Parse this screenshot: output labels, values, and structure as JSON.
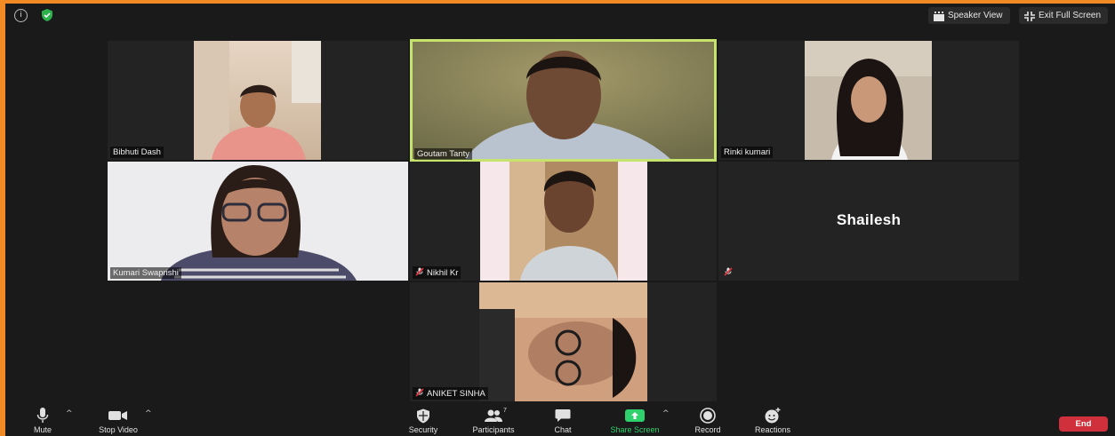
{
  "topbar": {
    "speaker_view_label": "Speaker View",
    "exit_full_screen_label": "Exit Full Screen"
  },
  "participants": [
    {
      "name": "Bibhuti Dash",
      "muted": false,
      "active": false
    },
    {
      "name": "Goutam Tanty",
      "muted": false,
      "active": true
    },
    {
      "name": "Rinki kumari",
      "muted": false,
      "active": false
    },
    {
      "name": "Kumari Swaprishi",
      "muted": false,
      "active": false
    },
    {
      "name": "Nikhil Kr",
      "muted": true,
      "active": false
    },
    {
      "name": "Shailesh",
      "muted": true,
      "active": false,
      "video_off": true
    },
    {
      "name": "ANIKET SINHA",
      "muted": true,
      "active": false
    }
  ],
  "toolbar": {
    "mute_label": "Mute",
    "stop_video_label": "Stop Video",
    "security_label": "Security",
    "participants_label": "Participants",
    "participants_count": "7",
    "chat_label": "Chat",
    "share_screen_label": "Share Screen",
    "record_label": "Record",
    "reactions_label": "Reactions",
    "end_label": "End"
  },
  "colors": {
    "window_border": "#f08a24",
    "active_speaker": "#c6e36e",
    "share_green": "#2ed16b",
    "end_red": "#d0303b",
    "background": "#1a1a1a"
  },
  "icons": [
    "info-icon",
    "shield-check-icon",
    "speaker-view-icon",
    "exit-full-screen-icon",
    "microphone-icon",
    "video-camera-icon",
    "security-shield-icon",
    "participants-icon",
    "chat-bubble-icon",
    "share-screen-icon",
    "record-icon",
    "reactions-icon",
    "muted-mic-icon"
  ]
}
